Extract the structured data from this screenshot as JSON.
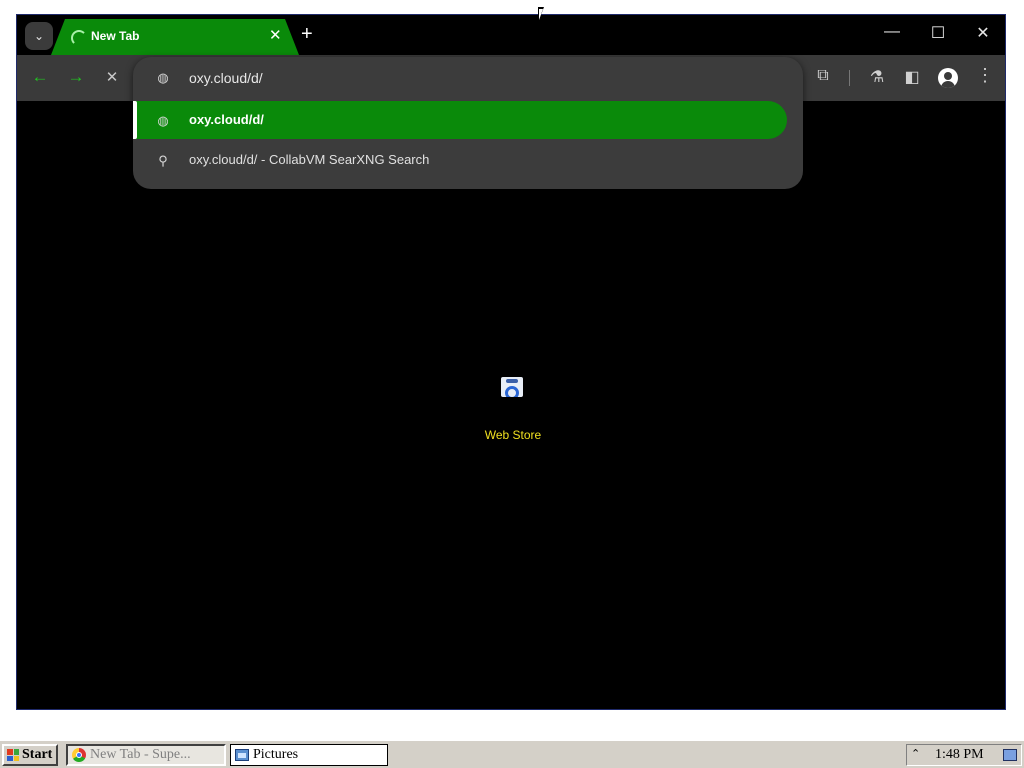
{
  "browser": {
    "tab": {
      "title": "New Tab",
      "close_glyph": "✕"
    },
    "new_tab_glyph": "+",
    "tab_search_glyph": "⌄",
    "window_controls": {
      "minimize": "—",
      "maximize": "☐",
      "close": "✕"
    },
    "nav": {
      "back": "←",
      "forward": "→",
      "stop": "✕"
    },
    "toolbar_icons": [
      "extensions-icon",
      "labs-icon",
      "side-panel-icon",
      "profile-icon",
      "menu-icon"
    ],
    "toolbar_glyphs": {
      "extensions": "⧉",
      "labs": "⚗",
      "side_panel": "◧",
      "menu": "⋮"
    },
    "omnibox": {
      "input_value": "oxy.cloud/d/",
      "suggestions": [
        {
          "icon": "globe-icon",
          "text": "oxy.cloud/d/",
          "selected": true
        },
        {
          "icon": "search-icon",
          "text": "oxy.cloud/d/ - CollabVM SearXNG Search",
          "selected": false
        }
      ],
      "globe_glyph": "◍",
      "search_glyph": "⚲"
    },
    "page": {
      "shortcut_label": "Web Store"
    },
    "colors": {
      "accent": "#0a8a0a",
      "toolbar": "#3a3a3a",
      "label": "#f0e020"
    }
  },
  "taskbar": {
    "start_label": "Start",
    "tasks": [
      {
        "label": "New Tab - Supe...",
        "active": true
      },
      {
        "label": "Pictures",
        "active": false
      }
    ],
    "tray_arrow": "⌃",
    "clock": "1:48 PM"
  }
}
